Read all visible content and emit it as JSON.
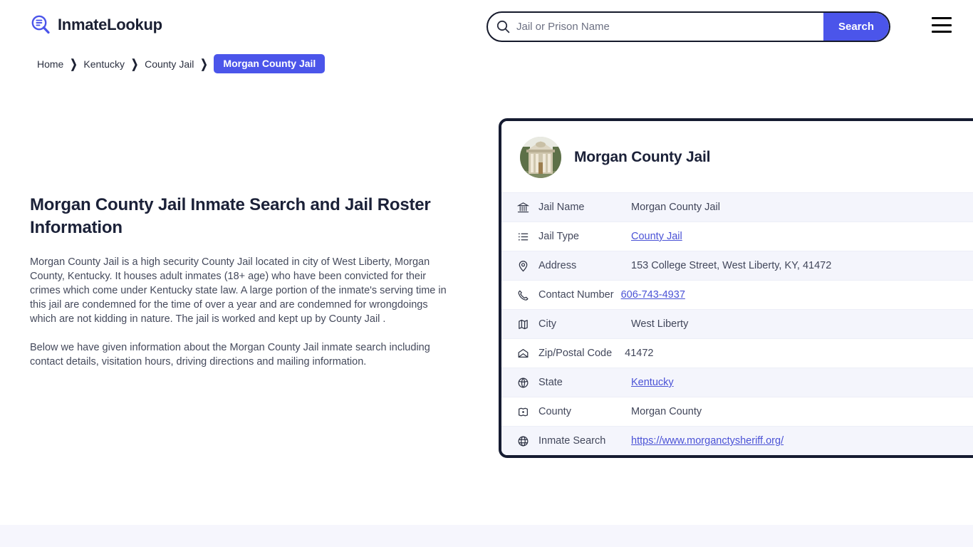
{
  "header": {
    "logo_text": "InmateLookup",
    "logo_icon": "magnifier-list-icon",
    "menu_icon": "hamburger-menu-icon"
  },
  "search": {
    "icon": "search-icon",
    "placeholder": "Jail or Prison Name",
    "value": "",
    "button_label": "Search",
    "button_color": "#4b55ea"
  },
  "breadcrumb": {
    "items": [
      {
        "label": "Home",
        "current": false
      },
      {
        "label": "Kentucky",
        "current": false
      },
      {
        "label": "County Jail",
        "current": false
      },
      {
        "label": "Morgan County Jail",
        "current": true
      }
    ],
    "separator": "❯",
    "current_bg": "#4b55ea"
  },
  "main": {
    "title": "Morgan County Jail Inmate Search and Jail Roster Information",
    "paragraph1": "Morgan County Jail is a high security County Jail located in city of West Liberty, Morgan County, Kentucky. It houses adult inmates (18+ age) who have been convicted for their crimes which come under Kentucky state law. A large portion of the inmate's serving time in this jail are condemned for the time of over a year and are condemned for wrongdoings which are not kidding in nature. The jail is worked and kept up by County Jail .",
    "paragraph2": "Below we have given information about the Morgan County Jail inmate search including contact details, visitation hours, driving directions and mailing information."
  },
  "card": {
    "avatar_icon": "courthouse-photo",
    "title": "Morgan County Jail",
    "border_color": "#151b31",
    "rows": [
      {
        "icon": "bank-icon",
        "label": "Jail Name",
        "value": "Morgan County Jail",
        "link": false
      },
      {
        "icon": "list-icon",
        "label": "Jail Type",
        "value": "County Jail",
        "link": true
      },
      {
        "icon": "location-pin-icon",
        "label": "Address",
        "value": "153 College Street, West Liberty, KY, 41472",
        "link": false
      },
      {
        "icon": "phone-icon",
        "label": "Contact Number",
        "value": "606-743-4937",
        "link": true
      },
      {
        "icon": "map-icon",
        "label": "City",
        "value": "West Liberty",
        "link": false
      },
      {
        "icon": "envelope-icon",
        "label": "Zip/Postal Code",
        "value": "41472",
        "link": false
      },
      {
        "icon": "globe-icon",
        "label": "State",
        "value": "Kentucky",
        "link": true
      },
      {
        "icon": "region-icon",
        "label": "County",
        "value": "Morgan County",
        "link": false
      },
      {
        "icon": "www-globe-icon",
        "label": "Inmate Search",
        "value": "https://www.morganctysheriff.org/",
        "link": true
      }
    ]
  }
}
